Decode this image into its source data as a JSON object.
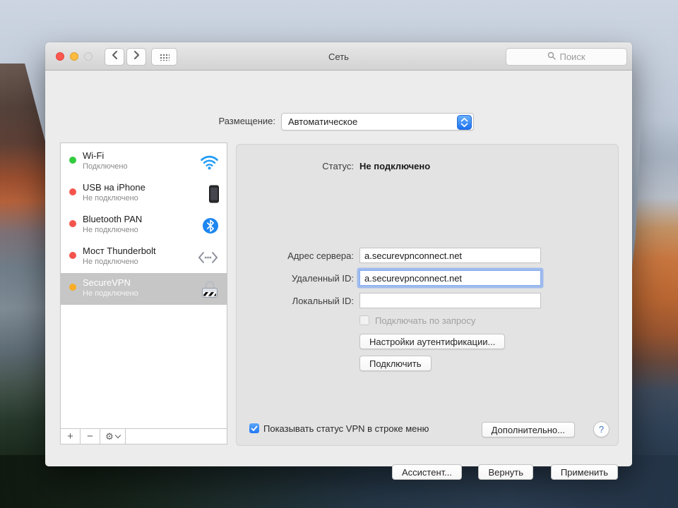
{
  "window": {
    "title": "Сеть"
  },
  "titlebar": {
    "search_placeholder": "Поиск"
  },
  "location": {
    "label": "Размещение:",
    "value": "Автоматическое"
  },
  "sidebar": {
    "items": [
      {
        "name": "Wi-Fi",
        "status": "Подключено",
        "dot_color": "#32cb3e",
        "icon": "wifi-icon",
        "selected": false
      },
      {
        "name": "USB на iPhone",
        "status": "Не подключено",
        "dot_color": "#f5544d",
        "icon": "iphone-icon",
        "selected": false
      },
      {
        "name": "Bluetooth PAN",
        "status": "Не подключено",
        "dot_color": "#f5544d",
        "icon": "bluetooth-icon",
        "selected": false
      },
      {
        "name": "Мост Thunderbolt",
        "status": "Не подключено",
        "dot_color": "#f5544d",
        "icon": "thunderbolt-bridge-icon",
        "selected": false
      },
      {
        "name": "SecureVPN",
        "status": "Не подключено",
        "dot_color": "#f8ac27",
        "icon": "vpn-lock-icon",
        "selected": true
      }
    ],
    "add_label": "+",
    "remove_label": "−"
  },
  "main": {
    "status_label": "Статус:",
    "status_value": "Не подключено",
    "fields": [
      {
        "label": "Адрес сервера:",
        "value": "a.securevpnconnect.net",
        "focused": false
      },
      {
        "label": "Удаленный ID:",
        "value": "a.securevpnconnect.net",
        "focused": true
      },
      {
        "label": "Локальный ID:",
        "value": "",
        "focused": false
      }
    ],
    "connect_on_demand": {
      "label": "Подключать по запросу",
      "checked": false,
      "disabled": true
    },
    "auth_button": "Настройки аутентификации...",
    "connect_button": "Подключить",
    "show_vpn_status": {
      "label": "Показывать статус VPN в строке меню",
      "checked": true
    },
    "advanced_button": "Дополнительно...",
    "help_label": "?"
  },
  "footer": {
    "assistant_button": "Ассистент...",
    "revert_button": "Вернуть",
    "apply_button": "Применить"
  },
  "icons": {
    "gear": "⚙"
  },
  "colors": {
    "accent_blue": "#2b7ff7",
    "selected_row_bg": "#c6c6c6",
    "status_green": "#32cb3e",
    "status_red": "#f5544d",
    "status_orange": "#f8ac27",
    "focus_ring": "#6f9ff2",
    "panel_bg": "#e3e3e3",
    "window_bg": "#ececec"
  }
}
